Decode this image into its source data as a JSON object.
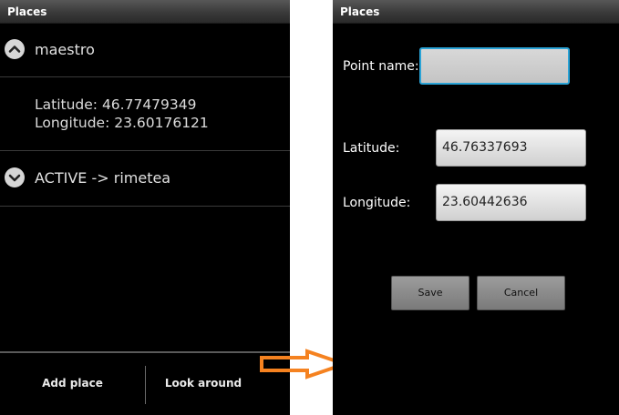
{
  "left": {
    "title": "Places",
    "groups": [
      {
        "name": "maestro",
        "expanded": true,
        "latitude_text": "Latitude: 46.77479349",
        "longitude_text": "Longitude: 23.60176121"
      },
      {
        "name": "ACTIVE -> rimetea",
        "expanded": false
      }
    ],
    "buttons": {
      "add_place": "Add place",
      "look_around": "Look around"
    }
  },
  "right": {
    "title": "Places",
    "fields": {
      "point_name": {
        "label": "Point name:",
        "value": ""
      },
      "latitude": {
        "label": "Latitude:",
        "value": "46.76337693"
      },
      "longitude": {
        "label": "Longitude:",
        "value": "23.60442636"
      }
    },
    "buttons": {
      "save": "Save",
      "cancel": "Cancel"
    }
  },
  "colors": {
    "arrow": "#f58220",
    "focus": "#2aa3d6",
    "background": "#000000"
  }
}
